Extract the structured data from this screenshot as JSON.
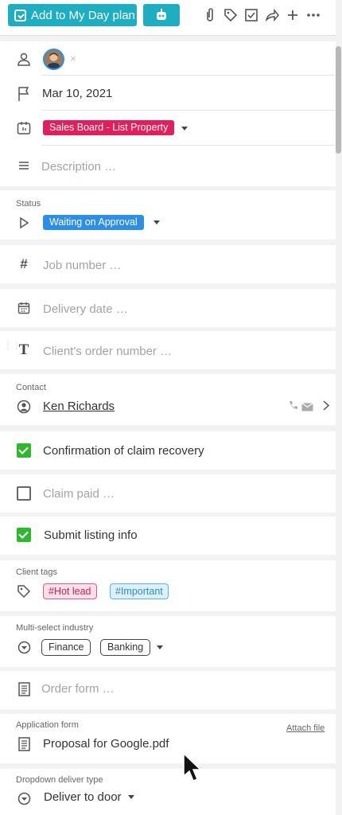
{
  "toolbar": {
    "my_day_label": "Add to My Day plan",
    "icons": [
      "attachment-icon",
      "tag-icon",
      "checklist-icon",
      "share-icon",
      "add-icon",
      "more-icon"
    ]
  },
  "assignee": {
    "remove": "×"
  },
  "due_date": "Mar 10, 2021",
  "board": {
    "label": "Sales Board - List Property",
    "color": "#e01f5c"
  },
  "description": {
    "placeholder": "Description …"
  },
  "status": {
    "label": "Status",
    "value": "Waiting on Approval",
    "color": "#2d8ee6"
  },
  "job_number": {
    "placeholder": "Job number …"
  },
  "delivery_date": {
    "placeholder": "Delivery date …"
  },
  "client_order": {
    "placeholder": "Client's order number …"
  },
  "contact": {
    "label": "Contact",
    "name": "Ken Richards"
  },
  "checks": [
    {
      "label": "Confirmation of claim recovery",
      "checked": true
    },
    {
      "label": "Claim paid …",
      "checked": false
    },
    {
      "label": "Submit listing info",
      "checked": true
    }
  ],
  "client_tags": {
    "label": "Client tags",
    "tags": [
      "#Hot lead",
      "#Important"
    ]
  },
  "industry": {
    "label": "Multi-select industry",
    "values": [
      "Finance",
      "Banking"
    ]
  },
  "order_form": {
    "placeholder": "Order form …"
  },
  "application_form": {
    "label": "Application form",
    "attach": "Attach file",
    "file": "Proposal for Google.pdf"
  },
  "deliver_type": {
    "label": "Dropdown deliver type",
    "value": "Deliver to door"
  }
}
